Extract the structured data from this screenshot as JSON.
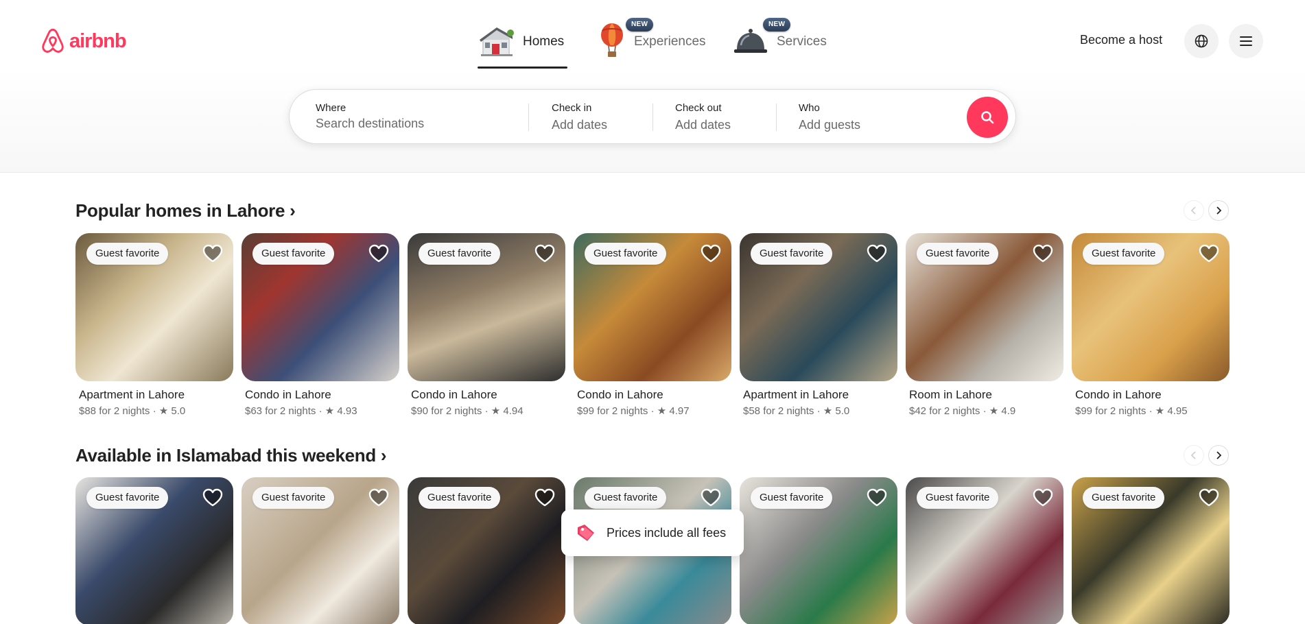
{
  "header": {
    "logo_text": "airbnb",
    "brand_color": "#FF385C",
    "tabs": [
      {
        "label": "Homes",
        "icon": "house-icon",
        "active": true
      },
      {
        "label": "Experiences",
        "icon": "hot-air-balloon-icon",
        "badge": "NEW"
      },
      {
        "label": "Services",
        "icon": "service-bell-icon",
        "badge": "NEW"
      }
    ],
    "host_link": "Become a host",
    "globe_icon": "globe-icon",
    "menu_icon": "menu-icon"
  },
  "search": {
    "where_label": "Where",
    "where_placeholder": "Search destinations",
    "checkin_label": "Check in",
    "checkin_value": "Add dates",
    "checkout_label": "Check out",
    "checkout_value": "Add dates",
    "who_label": "Who",
    "who_value": "Add guests",
    "button_icon": "search-icon"
  },
  "sections": [
    {
      "title": "Popular homes in Lahore ›",
      "cards": [
        {
          "badge": "Guest favorite",
          "title": "Apartment in Lahore",
          "subtitle": "$88 for 2 nights · ★ 5.0"
        },
        {
          "badge": "Guest favorite",
          "title": "Condo in Lahore",
          "subtitle": "$63 for 2 nights · ★ 4.93"
        },
        {
          "badge": "Guest favorite",
          "title": "Condo in Lahore",
          "subtitle": "$90 for 2 nights · ★ 4.94"
        },
        {
          "badge": "Guest favorite",
          "title": "Condo in Lahore",
          "subtitle": "$99 for 2 nights · ★ 4.97"
        },
        {
          "badge": "Guest favorite",
          "title": "Apartment in Lahore",
          "subtitle": "$58 for 2 nights · ★ 5.0"
        },
        {
          "badge": "Guest favorite",
          "title": "Room in Lahore",
          "subtitle": "$42 for 2 nights · ★ 4.9"
        },
        {
          "badge": "Guest favorite",
          "title": "Condo in Lahore",
          "subtitle": "$99 for 2 nights · ★ 4.95"
        }
      ]
    },
    {
      "title": "Available in Islamabad this weekend ›",
      "cards": [
        {
          "badge": "Guest favorite"
        },
        {
          "badge": "Guest favorite"
        },
        {
          "badge": "Guest favorite"
        },
        {
          "badge": "Guest favorite"
        },
        {
          "badge": "Guest favorite"
        },
        {
          "badge": "Guest favorite"
        },
        {
          "badge": "Guest favorite"
        }
      ]
    }
  ],
  "toast": {
    "icon": "price-tag-icon",
    "text": "Prices include all fees"
  }
}
